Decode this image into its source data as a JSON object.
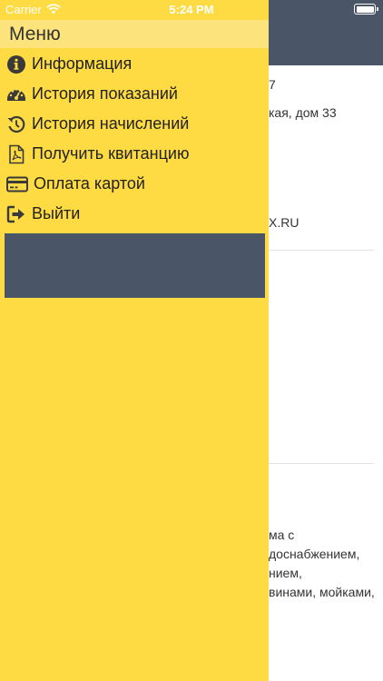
{
  "status_bar": {
    "carrier": "Carrier",
    "time": "5:24 PM"
  },
  "menu": {
    "title": "Меню",
    "items": [
      {
        "label": "Информация",
        "icon": "info-icon"
      },
      {
        "label": "История показаний",
        "icon": "gauge-icon"
      },
      {
        "label": "История начислений",
        "icon": "history-icon"
      },
      {
        "label": "Получить квитанцию",
        "icon": "pdf-file-icon"
      },
      {
        "label": "Оплата картой",
        "icon": "credit-card-icon"
      },
      {
        "label": "Выйти",
        "icon": "sign-out-icon"
      }
    ]
  },
  "background": {
    "line1": "7",
    "line2": "кая, дом 33",
    "line3": "X.RU",
    "line4": "ма с",
    "line5": "доснабжением,",
    "line6": "нием,",
    "line7": "винами, мойками,"
  },
  "colors": {
    "drawer": "#fedb42",
    "menu_header": "#fce37c",
    "header_bar": "#4a5568"
  }
}
